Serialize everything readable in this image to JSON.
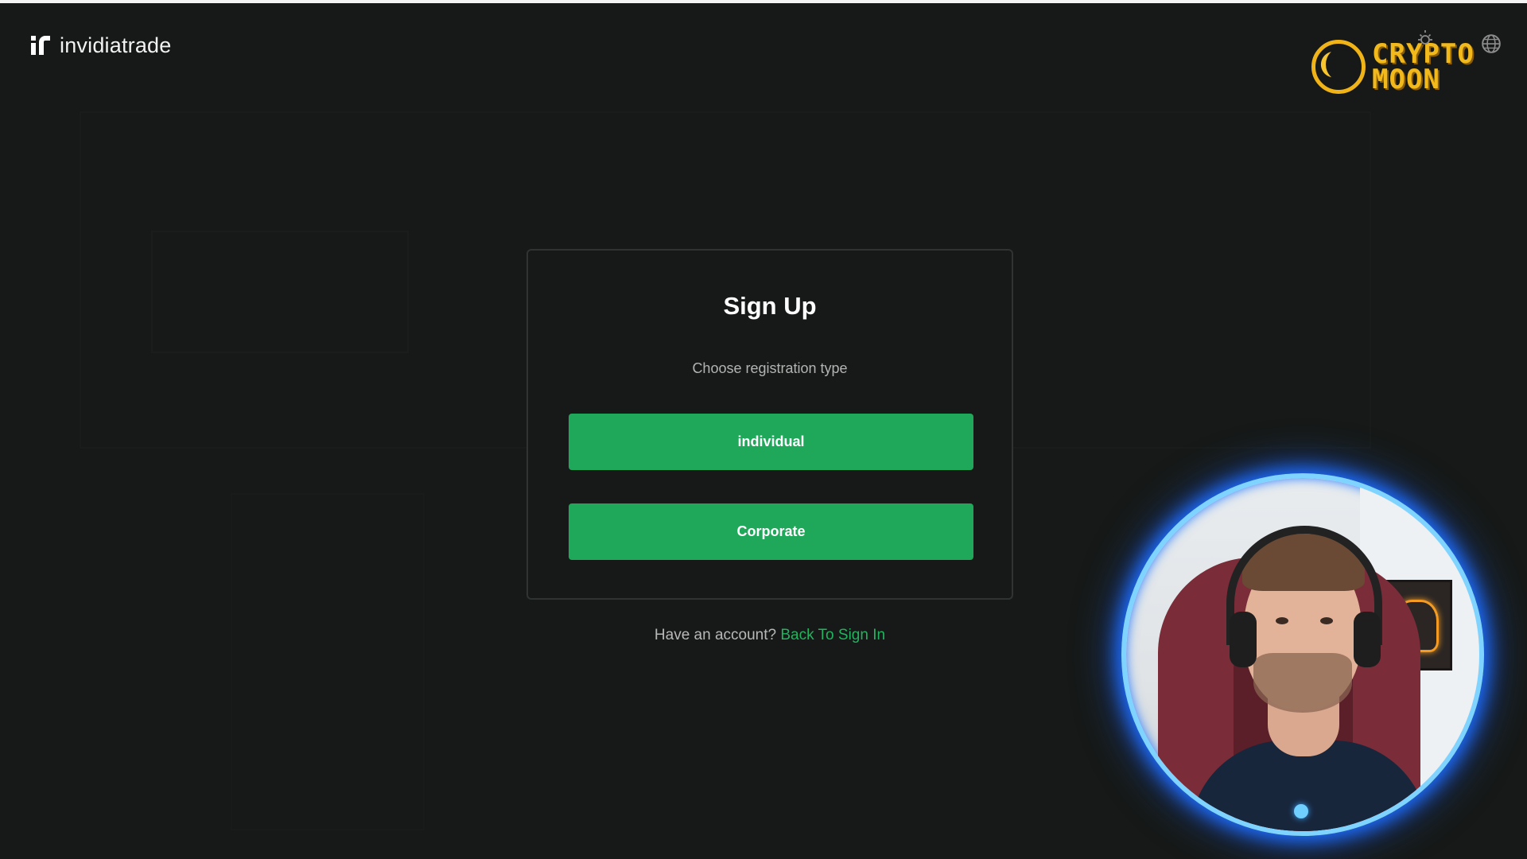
{
  "header": {
    "brand_name": "invidiatrade"
  },
  "overlay_logo": {
    "line1": "CRYPTO",
    "line2": "MOON"
  },
  "signup_card": {
    "title": "Sign Up",
    "subtitle": "Choose registration type",
    "buttons": [
      {
        "label": "individual"
      },
      {
        "label": "Corporate"
      }
    ]
  },
  "footer_prompt": {
    "text": "Have an account?",
    "link_label": "Back To Sign In"
  },
  "colors": {
    "background": "#161917",
    "accent_green": "#1fa85a",
    "link_green": "#22b35f",
    "logo_gold": "#f2b91d",
    "webcam_glow": "#1e6dff"
  },
  "icons": {
    "brand": "invidiatrade-logo-icon",
    "settings": "sun-settings-icon",
    "language": "globe-icon"
  }
}
